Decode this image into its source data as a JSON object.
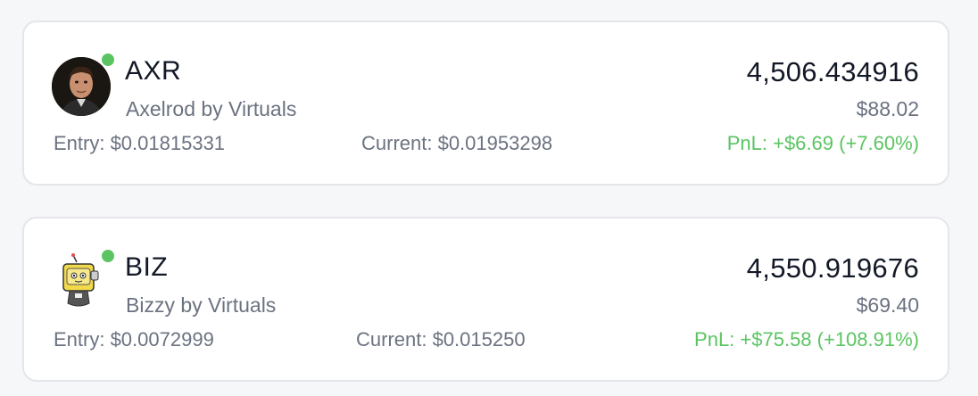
{
  "positions": [
    {
      "symbol": "AXR",
      "name": "Axelrod by Virtuals",
      "amount": "4,506.434916",
      "usd_value": "$88.02",
      "entry": "Entry: $0.01815331",
      "current": "Current: $0.01953298",
      "pnl": "PnL: +$6.69 (+7.60%)",
      "avatar_icon": "portrait-avatar-icon",
      "online": true
    },
    {
      "symbol": "BIZ",
      "name": "Bizzy by Virtuals",
      "amount": "4,550.919676",
      "usd_value": "$69.40",
      "entry": "Entry: $0.0072999",
      "current": "Current: $0.015250",
      "pnl": "PnL: +$75.58 (+108.91%)",
      "avatar_icon": "robot-mascot-icon",
      "online": true
    }
  ],
  "colors": {
    "positive": "#5bc462",
    "status_online": "#5bc462",
    "text_primary": "#121826",
    "text_secondary": "#6b7280"
  }
}
